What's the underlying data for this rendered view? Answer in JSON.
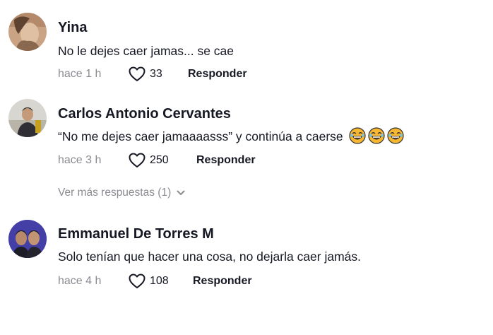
{
  "comments": [
    {
      "author": "Yina",
      "text": "No le dejes caer jamas... se cae",
      "time": "hace 1 h",
      "likes": "33",
      "reply_label": "Responder",
      "avatar_icon": "avatar-photo"
    },
    {
      "author": "Carlos Antonio Cervantes",
      "text": "“No me dejes caer jamaaaasss” y continúa a caerse",
      "emojis": [
        "joy-emoji",
        "joy-emoji",
        "joy-emoji"
      ],
      "time": "hace 3 h",
      "likes": "250",
      "reply_label": "Responder",
      "more_replies": "Ver más respuestas (1)",
      "avatar_icon": "avatar-photo"
    },
    {
      "author": "Emmanuel De Torres M",
      "text": "Solo tenían que hacer una cosa, no dejarla caer jamás.",
      "time": "hace 4 h",
      "likes": "108",
      "reply_label": "Responder",
      "avatar_icon": "avatar-photo"
    }
  ],
  "colors": {
    "text": "#161823",
    "muted": "#8a8b91",
    "emoji": "#f7b731"
  }
}
